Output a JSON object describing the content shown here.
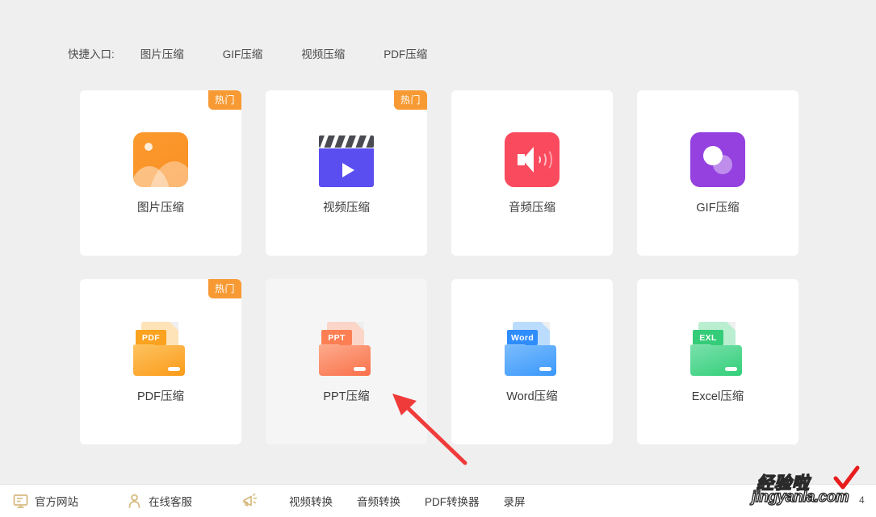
{
  "theme": {
    "page_background": "#efefef",
    "card_background": "#ffffff",
    "card_hover_background": "#f5f5f5",
    "badge_color": "#f79a33",
    "arrow_color": "#f03b3b",
    "text_color": "#3c3c3c"
  },
  "quick_entry": {
    "label": "快捷入口:",
    "links": [
      {
        "text": "图片压缩"
      },
      {
        "text": "GIF压缩"
      },
      {
        "text": "视频压缩"
      },
      {
        "text": "PDF压缩"
      }
    ]
  },
  "cards": [
    {
      "label": "图片压缩",
      "icon": "image-compress-icon",
      "badge": "热门",
      "hovered": false,
      "accent": "#fa9026"
    },
    {
      "label": "视频压缩",
      "icon": "video-compress-icon",
      "badge": "热门",
      "hovered": false,
      "accent": "#5a4ef0"
    },
    {
      "label": "音频压缩",
      "icon": "audio-compress-icon",
      "badge": "",
      "hovered": false,
      "accent": "#fa4a5e"
    },
    {
      "label": "GIF压缩",
      "icon": "gif-compress-icon",
      "badge": "",
      "hovered": false,
      "accent": "#9441df"
    },
    {
      "label": "PDF压缩",
      "icon": "pdf-compress-icon",
      "badge": "热门",
      "hovered": false,
      "accent": "#fba21e",
      "tag_text": "PDF"
    },
    {
      "label": "PPT压缩",
      "icon": "ppt-compress-icon",
      "badge": "",
      "hovered": true,
      "accent": "#fa7a55",
      "tag_text": "PPT"
    },
    {
      "label": "Word压缩",
      "icon": "word-compress-icon",
      "badge": "",
      "hovered": false,
      "accent": "#3f9bfb",
      "tag_text": "Word"
    },
    {
      "label": "Excel压缩",
      "icon": "excel-compress-icon",
      "badge": "",
      "hovered": false,
      "accent": "#3ed07e",
      "tag_text": "EXL"
    }
  ],
  "bottom_bar": {
    "website": "官方网站",
    "service": "在线客服",
    "links": [
      {
        "text": "视频转换"
      },
      {
        "text": "音频转换"
      },
      {
        "text": "PDF转换器"
      },
      {
        "text": "录屏"
      }
    ]
  },
  "watermark": {
    "chinese": "经验啦",
    "domain": "jingyanla.com",
    "suffix": "4"
  }
}
